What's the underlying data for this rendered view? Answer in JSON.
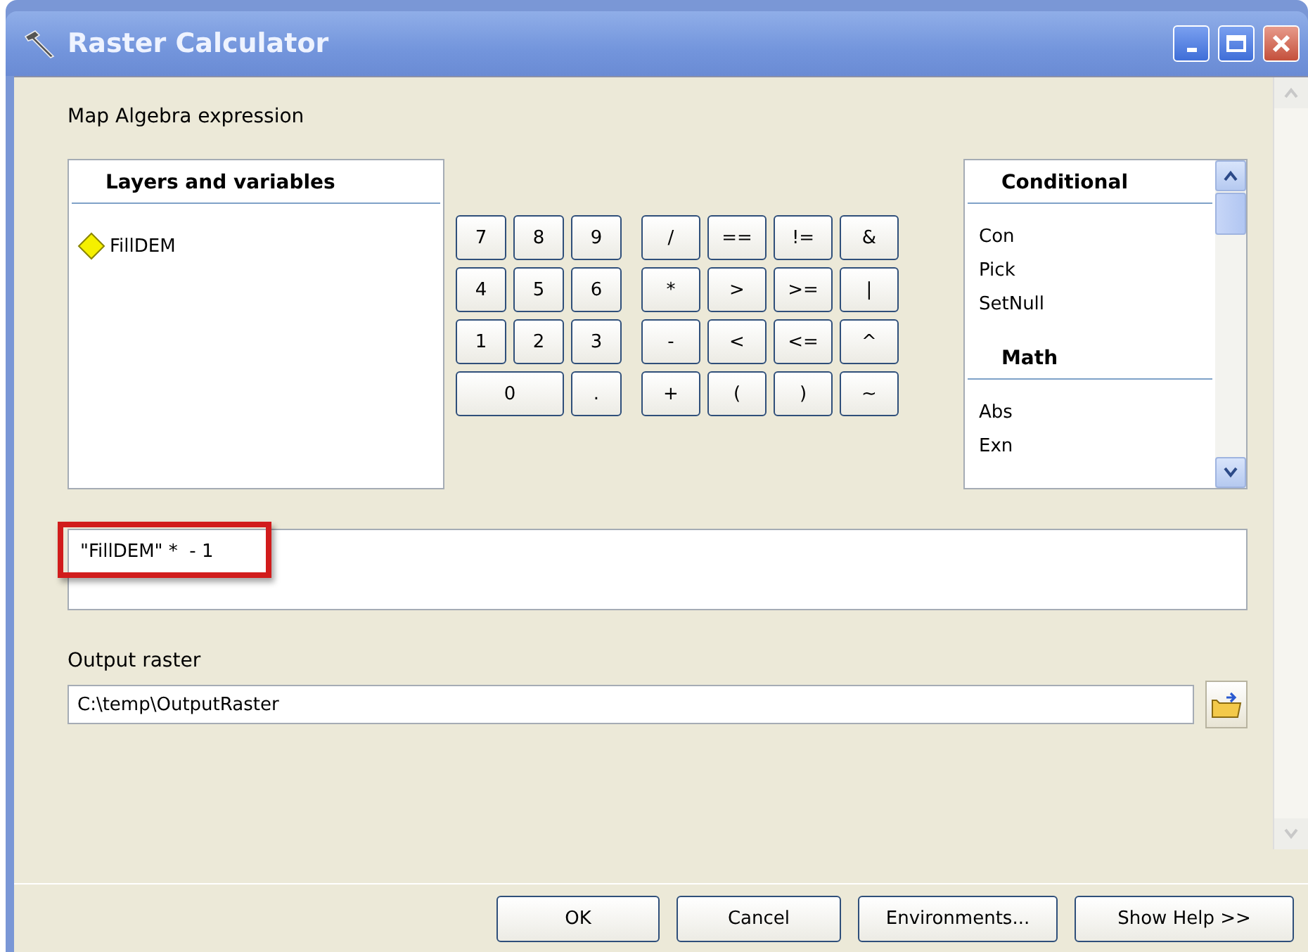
{
  "window": {
    "title": "Raster Calculator"
  },
  "expression_label": "Map Algebra expression",
  "layers": {
    "header": "Layers and variables",
    "items": [
      {
        "name": "FillDEM"
      }
    ]
  },
  "digit_keys": [
    {
      "label": "7",
      "kind": "normal"
    },
    {
      "label": "8",
      "kind": "normal"
    },
    {
      "label": "9",
      "kind": "normal"
    },
    {
      "label": "4",
      "kind": "normal"
    },
    {
      "label": "5",
      "kind": "normal"
    },
    {
      "label": "6",
      "kind": "normal"
    },
    {
      "label": "1",
      "kind": "normal"
    },
    {
      "label": "2",
      "kind": "normal"
    },
    {
      "label": "3",
      "kind": "normal"
    },
    {
      "label": "0",
      "kind": "wide"
    },
    {
      "label": ".",
      "kind": "normal"
    }
  ],
  "operator_keys": [
    "/",
    "==",
    "!=",
    "&",
    "*",
    ">",
    ">=",
    "|",
    "-",
    "<",
    "<=",
    "^",
    "+",
    "(",
    ")",
    "~"
  ],
  "functions": [
    {
      "header": "Conditional",
      "items": [
        "Con",
        "Pick",
        "SetNull"
      ]
    },
    {
      "header": "Math",
      "items": [
        "Abs",
        "Exn"
      ]
    }
  ],
  "expression": {
    "value": "\"FillDEM\" *  - 1",
    "highlighted": true
  },
  "output": {
    "label": "Output raster",
    "value": "C:\\temp\\OutputRaster"
  },
  "buttons": [
    "OK",
    "Cancel",
    "Environments...",
    "Show Help >>"
  ]
}
